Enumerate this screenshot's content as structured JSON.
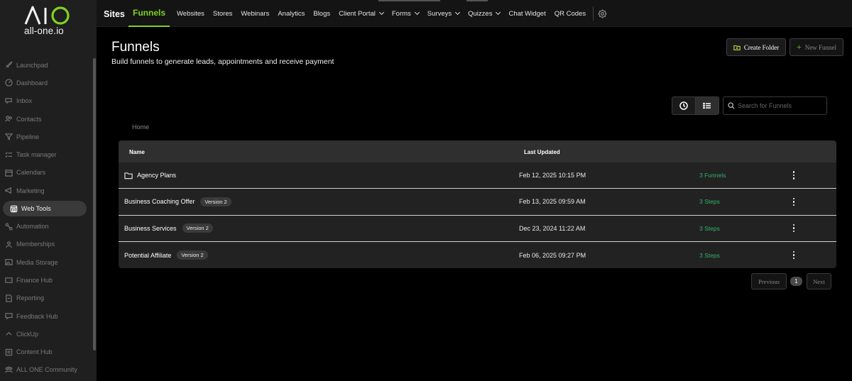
{
  "brand": {
    "logo_text": "all-one.io",
    "accent": "#7ed321"
  },
  "sidebar": {
    "items": [
      {
        "label": "Launchpad",
        "icon": "rocket-icon"
      },
      {
        "label": "Dashboard",
        "icon": "gauge-icon"
      },
      {
        "label": "Inbox",
        "icon": "chat-icon"
      },
      {
        "label": "Contacts",
        "icon": "users-icon"
      },
      {
        "label": "Pipeline",
        "icon": "funnel-icon"
      },
      {
        "label": "Task manager",
        "icon": "checklist-icon"
      },
      {
        "label": "Calendars",
        "icon": "calendar-icon"
      },
      {
        "label": "Marketing",
        "icon": "megaphone-icon"
      },
      {
        "label": "Web Tools",
        "icon": "web-icon",
        "active": true
      },
      {
        "label": "Automation",
        "icon": "automation-icon"
      },
      {
        "label": "Memberships",
        "icon": "members-icon"
      },
      {
        "label": "Media Storage",
        "icon": "image-icon"
      },
      {
        "label": "Finance Hub",
        "icon": "wallet-icon"
      },
      {
        "label": "Reporting",
        "icon": "report-icon"
      },
      {
        "label": "Feedback Hub",
        "icon": "feedback-icon"
      },
      {
        "label": "ClickUp",
        "icon": "clickup-icon"
      },
      {
        "label": "Content Hub",
        "icon": "content-icon"
      },
      {
        "label": "ALL ONE Community",
        "icon": "community-icon"
      }
    ]
  },
  "topnav": {
    "sites": "Sites",
    "tabs": [
      {
        "label": "Funnels",
        "active": true
      },
      {
        "label": "Websites"
      },
      {
        "label": "Stores"
      },
      {
        "label": "Webinars"
      },
      {
        "label": "Analytics"
      },
      {
        "label": "Blogs"
      },
      {
        "label": "Client Portal",
        "dropdown": true
      },
      {
        "label": "Forms",
        "dropdown": true
      },
      {
        "label": "Surveys",
        "dropdown": true
      },
      {
        "label": "Quizzes",
        "dropdown": true
      },
      {
        "label": "Chat Widget"
      },
      {
        "label": "QR Codes"
      }
    ]
  },
  "header": {
    "title": "Funnels",
    "subtitle": "Build funnels to generate leads, appointments and receive payment",
    "create_folder": "Create Folder",
    "new_funnel": "New Funnel"
  },
  "search": {
    "placeholder": "Search for Funnels"
  },
  "breadcrumb": "Home",
  "table": {
    "columns": {
      "name": "Name",
      "updated": "Last Updated"
    },
    "rows": [
      {
        "name": "Agency Plans",
        "folder": true,
        "badge": "",
        "updated": "Feb 12, 2025 10:15 PM",
        "count": "3 Funnels"
      },
      {
        "name": "Business Coaching Offer",
        "folder": false,
        "badge": "Version 2",
        "updated": "Feb 13, 2025 09:59 AM",
        "count": "3 Steps"
      },
      {
        "name": "Business Services",
        "folder": false,
        "badge": "Version 2",
        "updated": "Dec 23, 2024 11:22 AM",
        "count": "3 Steps"
      },
      {
        "name": "Potential Affiliate",
        "folder": false,
        "badge": "Version 2",
        "updated": "Feb 06, 2025 09:27 PM",
        "count": "3 Steps"
      }
    ]
  },
  "pagination": {
    "previous": "Previous",
    "page": "1",
    "next": "Next"
  }
}
